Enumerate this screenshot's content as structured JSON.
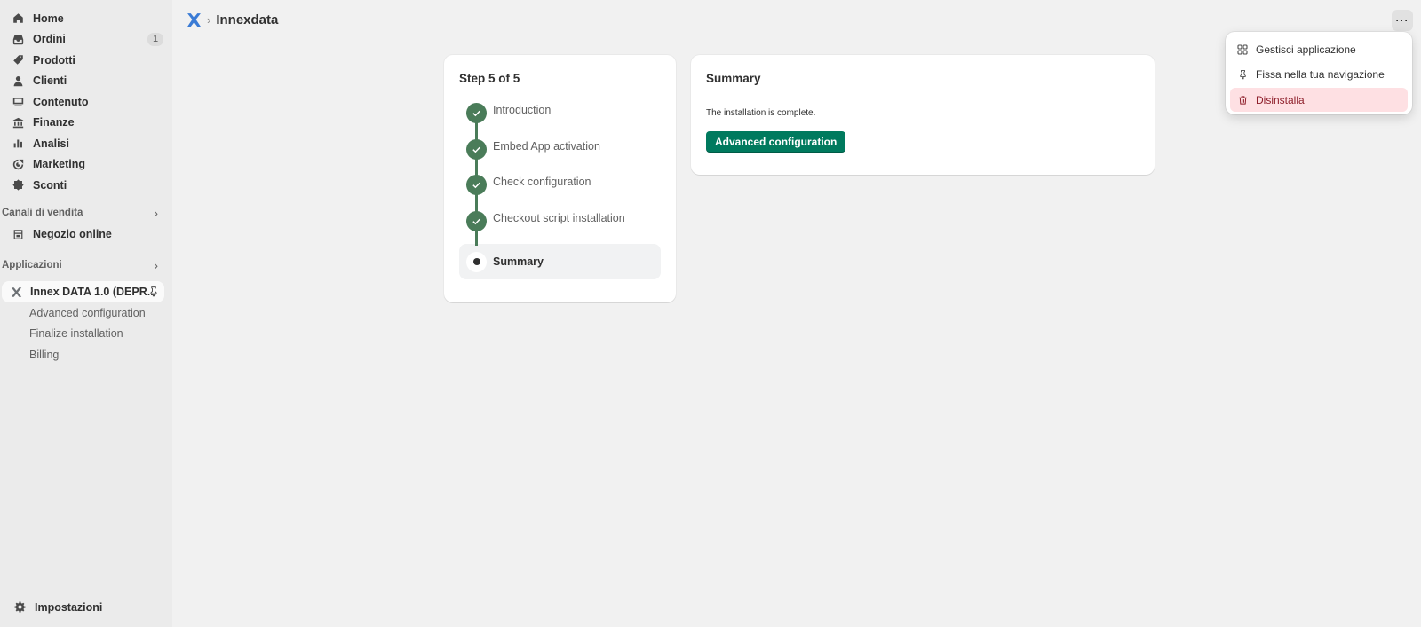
{
  "sidebar": {
    "nav": [
      {
        "label": "Home",
        "icon": "home-icon"
      },
      {
        "label": "Ordini",
        "icon": "inbox-icon",
        "badge": "1"
      },
      {
        "label": "Prodotti",
        "icon": "tag-icon"
      },
      {
        "label": "Clienti",
        "icon": "person-icon"
      },
      {
        "label": "Contenuto",
        "icon": "image-icon"
      },
      {
        "label": "Finanze",
        "icon": "bank-icon"
      },
      {
        "label": "Analisi",
        "icon": "bar-chart-icon"
      },
      {
        "label": "Marketing",
        "icon": "target-icon"
      },
      {
        "label": "Sconti",
        "icon": "discount-icon"
      }
    ],
    "sales_channels": {
      "title": "Canali di vendita",
      "items": [
        {
          "label": "Negozio online",
          "icon": "store-icon"
        }
      ]
    },
    "apps": {
      "title": "Applicazioni",
      "active_app": "Innex DATA 1.0 (DEPR...",
      "sub_items": [
        "Advanced configuration",
        "Finalize installation",
        "Billing"
      ]
    },
    "settings_label": "Impostazioni"
  },
  "topbar": {
    "separator": "›",
    "title": "Innexdata",
    "more_label": "···"
  },
  "steps_card": {
    "title": "Step 5 of 5",
    "steps": [
      {
        "label": "Introduction",
        "status": "complete"
      },
      {
        "label": "Embed App activation",
        "status": "complete"
      },
      {
        "label": "Check configuration",
        "status": "complete"
      },
      {
        "label": "Checkout script installation",
        "status": "complete"
      },
      {
        "label": "Summary",
        "status": "current"
      }
    ]
  },
  "summary_card": {
    "title": "Summary",
    "text": "The installation is complete.",
    "button_label": "Advanced configuration"
  },
  "menu": {
    "items": [
      {
        "label": "Gestisci applicazione",
        "icon": "apps-icon"
      },
      {
        "label": "Fissa nella tua navigazione",
        "icon": "pin-icon"
      },
      {
        "label": "Disinstalla",
        "icon": "trash-icon"
      }
    ]
  },
  "colors": {
    "primary": "#007a5e",
    "step_complete": "#4a7c59",
    "danger_bg": "#fee0e3",
    "danger_text": "#8e1f2b"
  }
}
